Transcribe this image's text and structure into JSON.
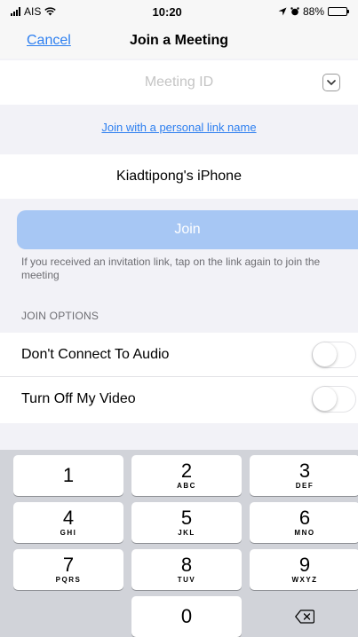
{
  "status_bar": {
    "carrier": "AIS",
    "time": "10:20",
    "battery": "88%"
  },
  "nav": {
    "cancel": "Cancel",
    "title": "Join a Meeting"
  },
  "meeting_id": {
    "placeholder": "Meeting ID",
    "value": ""
  },
  "personal_link": "Join with a personal link name",
  "name_field": {
    "value": "Kiadtipong's iPhone"
  },
  "join_button": "Join",
  "hint": "If you received an invitation link, tap on the link again to join the meeting",
  "join_options": {
    "header": "JOIN OPTIONS",
    "options": [
      {
        "label": "Don't Connect To Audio",
        "enabled": false
      },
      {
        "label": "Turn Off My Video",
        "enabled": false
      }
    ]
  },
  "keypad": {
    "keys": [
      {
        "digit": "1",
        "letters": ""
      },
      {
        "digit": "2",
        "letters": "ABC"
      },
      {
        "digit": "3",
        "letters": "DEF"
      },
      {
        "digit": "4",
        "letters": "GHI"
      },
      {
        "digit": "5",
        "letters": "JKL"
      },
      {
        "digit": "6",
        "letters": "MNO"
      },
      {
        "digit": "7",
        "letters": "PQRS"
      },
      {
        "digit": "8",
        "letters": "TUV"
      },
      {
        "digit": "9",
        "letters": "WXYZ"
      },
      {
        "digit": "0",
        "letters": ""
      }
    ]
  },
  "colors": {
    "accent": "#2d7ff0",
    "join_button_disabled": "#a7c7f4"
  }
}
